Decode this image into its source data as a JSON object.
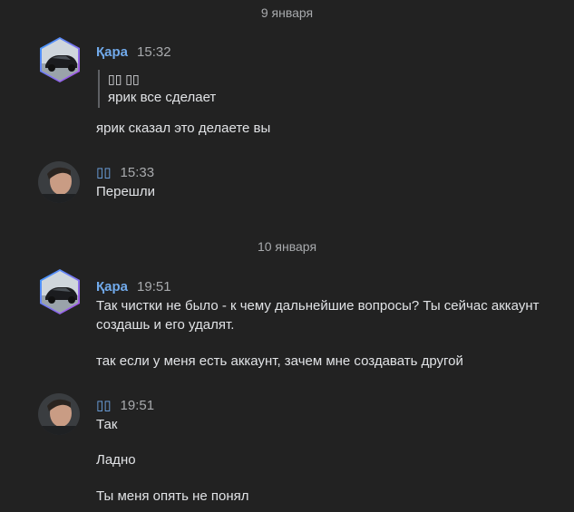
{
  "dates": [
    "9 января",
    "10 января"
  ],
  "messages": [
    {
      "author": "Қара",
      "time": "15:32",
      "quote": {
        "author": "▯▯ ▯▯",
        "text": "ярик все сделает"
      },
      "lines": [
        "ярик сказал это делаете вы"
      ]
    },
    {
      "author": "▯▯",
      "time": "15:33",
      "lines": [
        "Перешли"
      ]
    },
    {
      "author": "Қара",
      "time": "19:51",
      "lines": [
        "Так чистки не было - к чему дальнейшие вопросы? Ты сейчас аккаунт создашь и его удалят.",
        "так если у меня есть аккаунт, зачем мне создавать другой"
      ]
    },
    {
      "author": "▯▯",
      "time": "19:51",
      "lines": [
        "Так",
        "Ладно",
        "Ты меня опять не понял"
      ]
    }
  ],
  "colors": {
    "background": "#222222",
    "author": "#71aaeb",
    "text": "#e1e3e6",
    "muted": "#a8aaad",
    "avatar_ring_1": "#3aa0ff",
    "avatar_ring_2": "#b04fe0"
  }
}
